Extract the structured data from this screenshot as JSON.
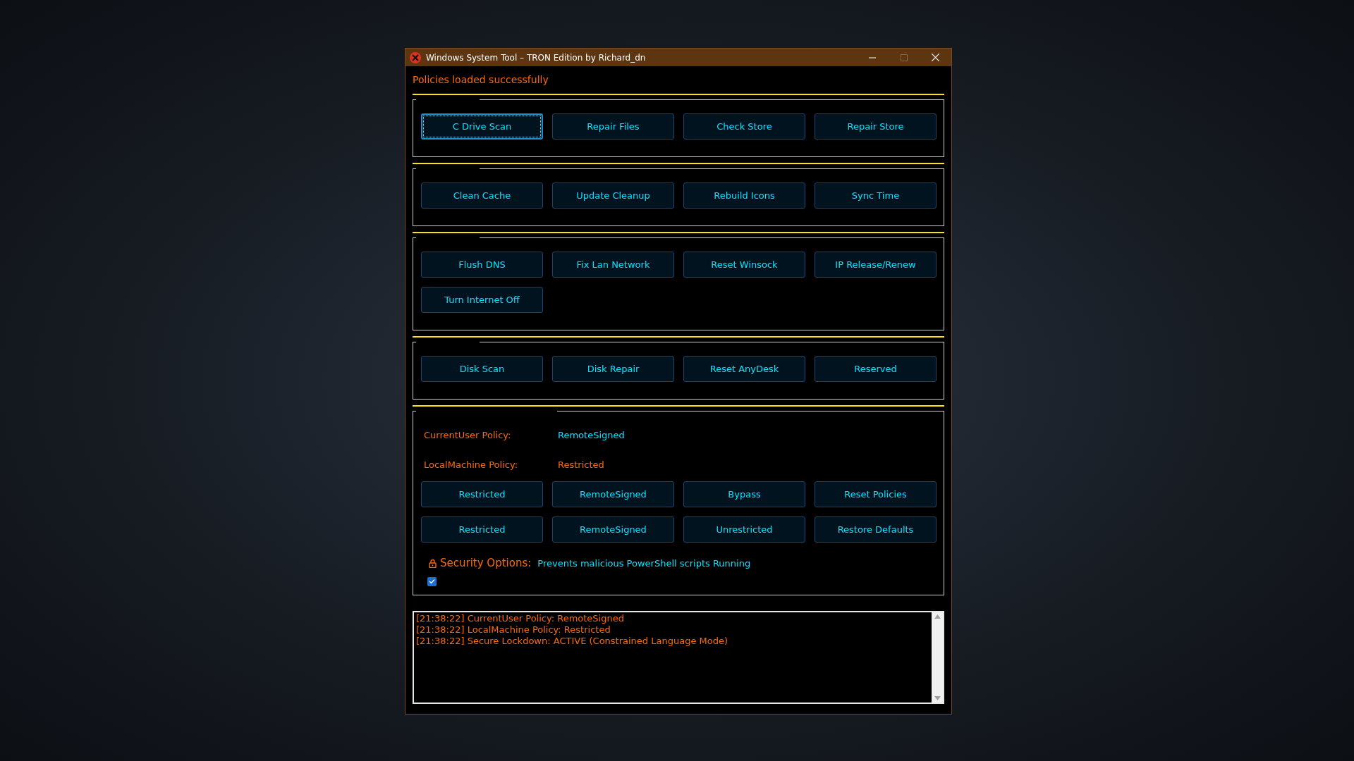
{
  "window": {
    "title": "Windows System Tool – TRON Edition by Richard_dn"
  },
  "status_message": "Policies loaded successfully",
  "button_groups": [
    {
      "buttons": [
        {
          "label": "C Drive Scan",
          "focused": true
        },
        {
          "label": "Repair Files",
          "focused": false
        },
        {
          "label": "Check Store",
          "focused": false
        },
        {
          "label": "Repair Store",
          "focused": false
        }
      ]
    },
    {
      "buttons": [
        {
          "label": "Clean Cache",
          "focused": false
        },
        {
          "label": "Update Cleanup",
          "focused": false
        },
        {
          "label": "Rebuild Icons",
          "focused": false
        },
        {
          "label": "Sync Time",
          "focused": false
        }
      ]
    },
    {
      "buttons": [
        {
          "label": "Flush DNS",
          "focused": false
        },
        {
          "label": "Fix Lan Network",
          "focused": false
        },
        {
          "label": "Reset Winsock",
          "focused": false
        },
        {
          "label": "IP Release/Renew",
          "focused": false
        },
        {
          "label": "Turn Internet Off",
          "focused": false
        }
      ]
    },
    {
      "buttons": [
        {
          "label": "Disk Scan",
          "focused": false
        },
        {
          "label": "Disk Repair",
          "focused": false
        },
        {
          "label": "Reset AnyDesk",
          "focused": false
        },
        {
          "label": "Reserved",
          "focused": false
        }
      ]
    }
  ],
  "policies": [
    {
      "label": "CurrentUser Policy:",
      "value": "RemoteSigned",
      "color": "#00e5ff"
    },
    {
      "label": "LocalMachine Policy:",
      "value": "Restricted",
      "color": "#ff6a00"
    }
  ],
  "policy_buttons": [
    {
      "label": "Restricted",
      "focused": false
    },
    {
      "label": "RemoteSigned",
      "focused": false
    },
    {
      "label": "Bypass",
      "focused": false
    },
    {
      "label": "Reset Policies",
      "focused": false
    },
    {
      "label": "Restricted",
      "focused": false
    },
    {
      "label": "RemoteSigned",
      "focused": false
    },
    {
      "label": "Unrestricted",
      "focused": false
    },
    {
      "label": "Restore Defaults",
      "focused": false
    }
  ],
  "security": {
    "label": "Security Options:",
    "description": "Prevents malicious PowerShell scripts Running",
    "checked": true
  },
  "log": {
    "lines": [
      "[21:38:22] CurrentUser Policy: RemoteSigned",
      "[21:38:22] LocalMachine Policy: Restricted",
      "[21:38:22] Secure Lockdown: ACTIVE (Constrained Language Mode)"
    ]
  }
}
